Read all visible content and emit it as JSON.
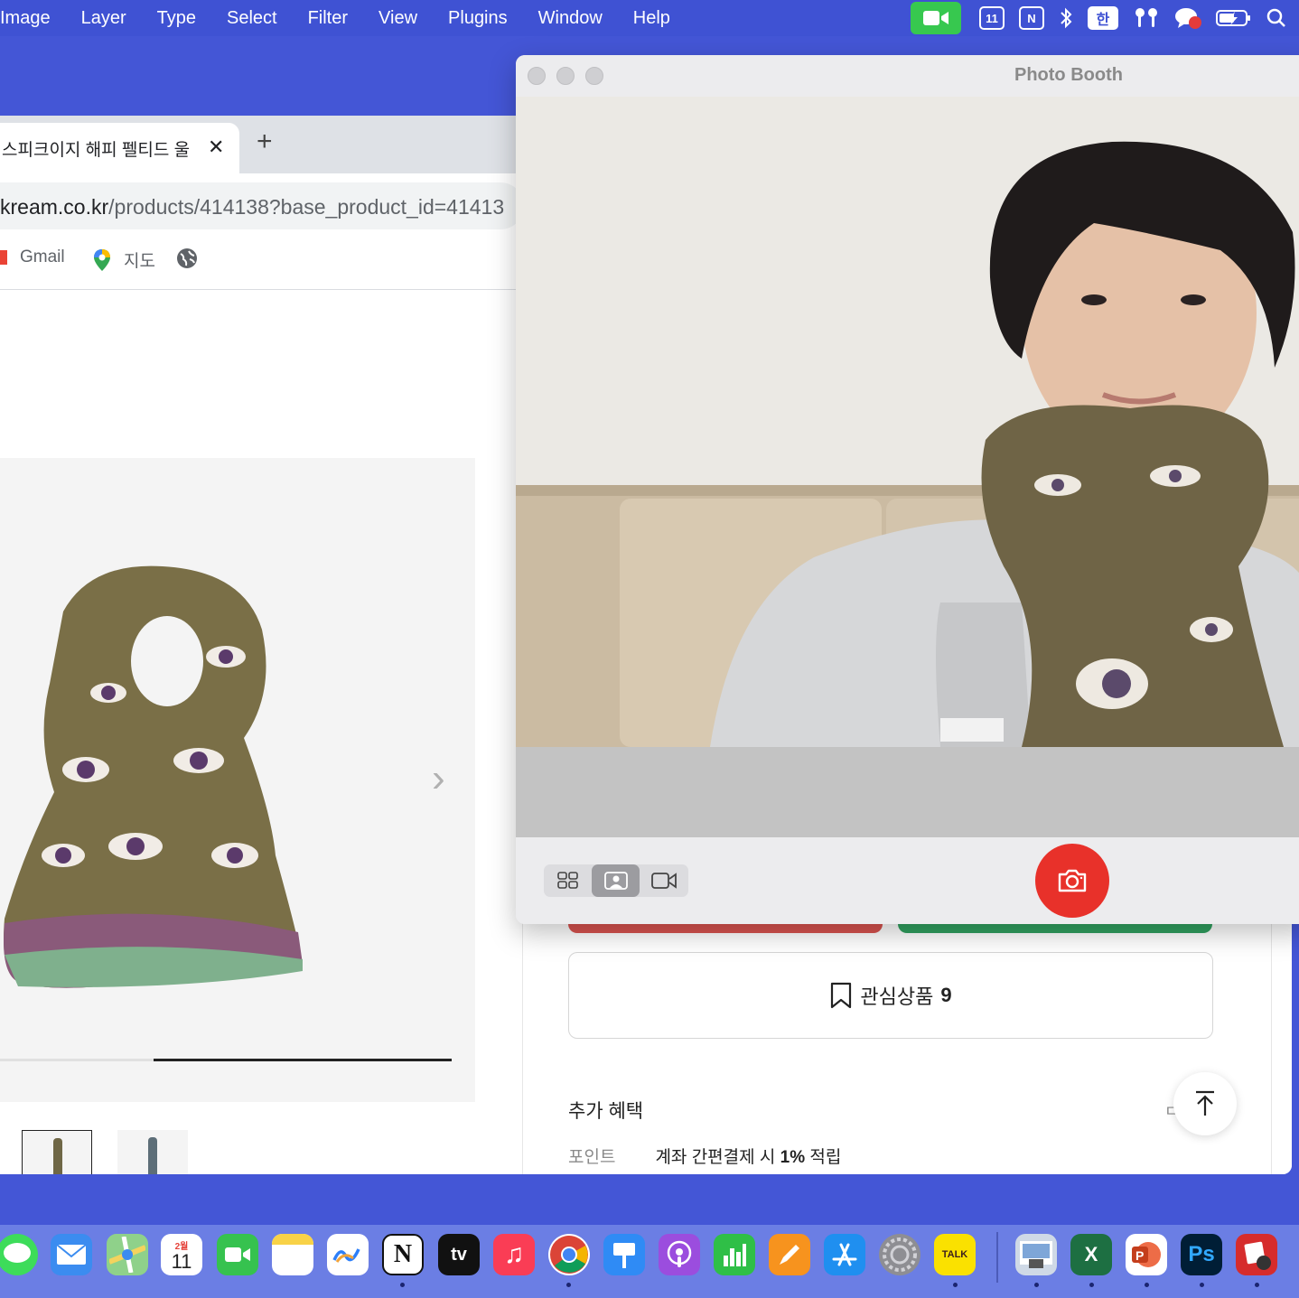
{
  "menubar": {
    "items": [
      "Image",
      "Layer",
      "Type",
      "Select",
      "Filter",
      "View",
      "Plugins",
      "Window",
      "Help"
    ],
    "status": {
      "calendar_day": "11",
      "notion_glyph": "N",
      "input_method": "한",
      "icons": [
        "facetime-icon",
        "calendar-icon",
        "notion-icon",
        "bluetooth-icon",
        "input-method-icon",
        "airpods-icon",
        "chat-icon",
        "battery-icon",
        "spotlight-icon"
      ]
    },
    "accent": "#3f52d3"
  },
  "browser": {
    "tab_title": "스피크이지 해피 펠티드 울 디",
    "tab_close": "✕",
    "new_tab": "+",
    "url_domain": "kream.co.kr",
    "url_path": "/products/414138?base_product_id=41413",
    "bookmarks": [
      {
        "label": "Gmail",
        "icon": "gmail-icon"
      },
      {
        "label": "지도",
        "icon": "maps-icon"
      },
      {
        "label": "",
        "icon": "globe-icon"
      }
    ],
    "gallery": {
      "next_arrow": "›",
      "progress": {
        "start": 0.34,
        "end": 1.0
      }
    },
    "wishlist": {
      "label": "관심상품",
      "count": "9"
    },
    "benefits": {
      "title": "추가 혜택",
      "side_mark": "ㄷ",
      "row_label": "포인트",
      "row_text_pre": "계좌 간편결제 시 ",
      "row_text_bold": "1%",
      "row_text_post": " 적립"
    },
    "to_top": "↑"
  },
  "photobooth": {
    "title": "Photo Booth",
    "mode_buttons": [
      "grid-mode-icon",
      "single-photo-mode-icon",
      "video-mode-icon"
    ],
    "active_mode": 1,
    "shutter_color": "#e8312a"
  },
  "dock": {
    "calendar_month": "2월",
    "calendar_day": "11",
    "notion": "N",
    "tv": "tv",
    "kakao": "TALK",
    "excel": "X",
    "photoshop": "Ps",
    "apps": [
      "messages",
      "mail",
      "maps",
      "calendar",
      "facetime",
      "notes",
      "freeform",
      "notion",
      "tv",
      "music",
      "chrome",
      "keynote",
      "podcasts",
      "numbers",
      "pages",
      "app-store",
      "system-settings",
      "kakaotalk",
      "preview",
      "excel",
      "powerpoint",
      "photoshop",
      "photo-booth"
    ]
  }
}
